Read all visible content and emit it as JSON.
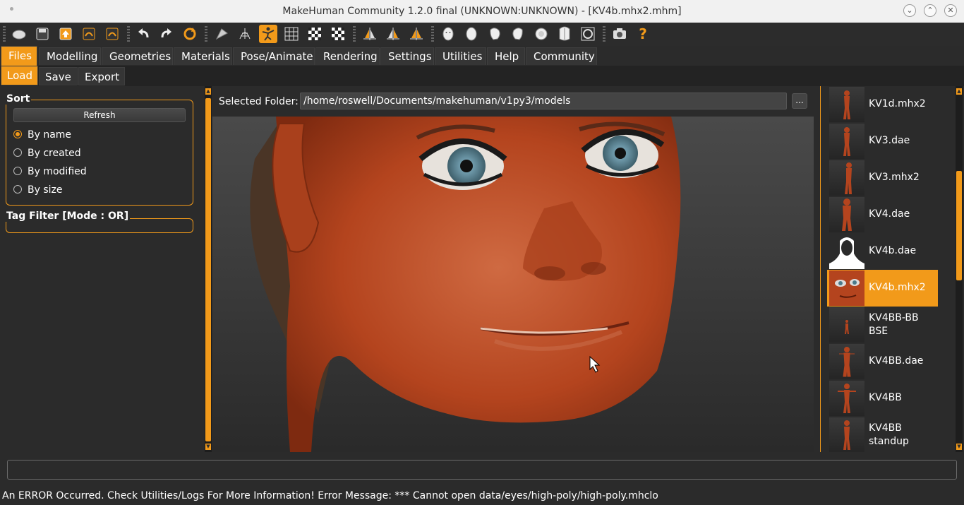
{
  "window": {
    "title": "MakeHuman Community 1.2.0 final (UNKNOWN:UNKNOWN) - [KV4b.mhx2.mhm]",
    "minimize_glyph": "⌄",
    "maximize_glyph": "⌃",
    "close_glyph": "✕"
  },
  "toolbar": {
    "icons": [
      "new-icon",
      "save-icon",
      "export-icon",
      "load-icon",
      "exit-icon",
      "undo-icon",
      "redo-icon",
      "reset-icon",
      "smooth-icon",
      "wireframe-icon",
      "pose-icon",
      "grid-icon",
      "checker-icon",
      "checker-alt-icon",
      "symmetry-right-icon",
      "symmetry-left-icon",
      "symmetry-icon",
      "face-front-icon",
      "face-back-icon",
      "face-left-icon",
      "face-right-icon",
      "face-top-icon",
      "head-bottom-icon",
      "global-view-icon",
      "camera-icon",
      "help-icon"
    ],
    "active_icon": "pose-icon",
    "help_glyph": "?"
  },
  "main_tabs": [
    "Files",
    "Modelling",
    "Geometries",
    "Materials",
    "Pose/Animate",
    "Rendering",
    "Settings",
    "Utilities",
    "Help",
    "Community"
  ],
  "active_main_tab": "Files",
  "sub_tabs": [
    "Load",
    "Save",
    "Export"
  ],
  "active_sub_tab": "Load",
  "sort": {
    "title": "Sort",
    "refresh_label": "Refresh",
    "options": [
      "By name",
      "By created",
      "By modified",
      "By size"
    ],
    "selected": "By name"
  },
  "tag_filter": {
    "title": "Tag Filter [Mode : OR]"
  },
  "folder": {
    "label": "Selected Folder:",
    "path": "/home/roswell/Documents/makehuman/v1py3/models",
    "browse_label": "..."
  },
  "files": [
    {
      "name": "KV1d.mhx2"
    },
    {
      "name": "KV3.dae"
    },
    {
      "name": "KV3.mhx2"
    },
    {
      "name": "KV4.dae"
    },
    {
      "name": "KV4b.dae"
    },
    {
      "name": "KV4b.mhx2"
    },
    {
      "name": "KV4BB-BB BSE"
    },
    {
      "name": "KV4BB.dae"
    },
    {
      "name": "KV4BB"
    },
    {
      "name": "KV4BB standup"
    }
  ],
  "selected_file": "KV4b.mhx2",
  "status": {
    "message": "An ERROR Occurred. Check Utilities/Logs For More Information! Error Message:  *** Cannot open data/eyes/high-poly/high-poly.mhclo"
  },
  "colors": {
    "accent": "#f29a1a",
    "background": "#2b2b2b",
    "skin": "#b4441e"
  }
}
